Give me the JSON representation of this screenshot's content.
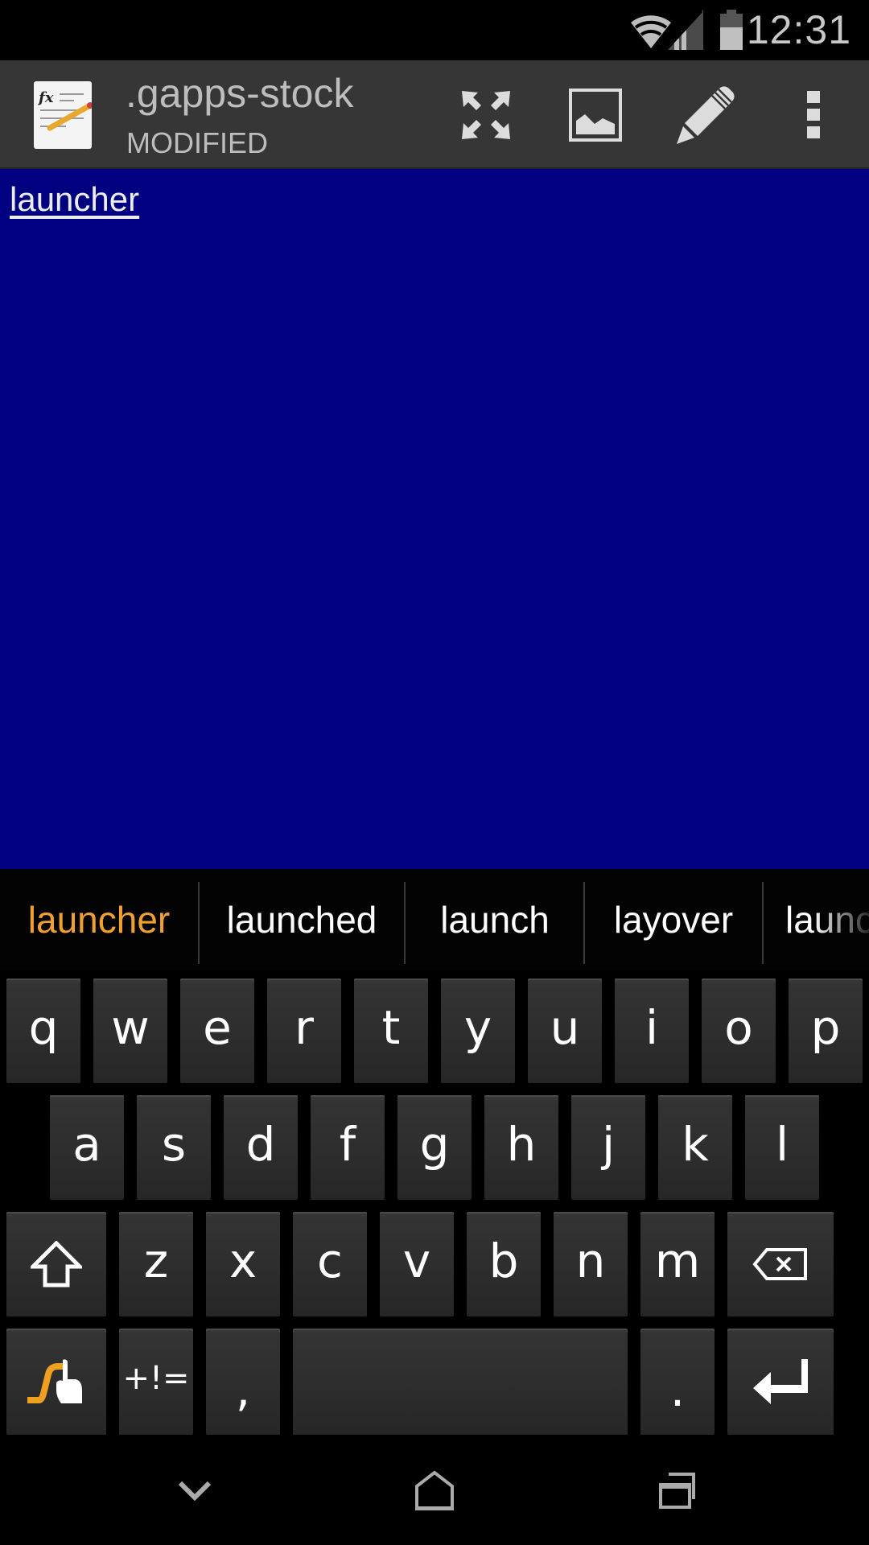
{
  "status_bar": {
    "time": "12:31",
    "icons": [
      "wifi-icon",
      "cell-signal-icon",
      "battery-icon"
    ]
  },
  "action_bar": {
    "app_icon": "text-editor-app-icon",
    "title": ".gapps-stock",
    "subtitle": "MODIFIED",
    "actions": [
      {
        "name": "fullscreen",
        "icon": "expand-arrows-icon"
      },
      {
        "name": "insert-image",
        "icon": "image-icon"
      },
      {
        "name": "edit",
        "icon": "pencil-icon"
      },
      {
        "name": "overflow-menu",
        "icon": "more-vertical-icon"
      }
    ]
  },
  "editor": {
    "content": "launcher",
    "background_color": "#000080"
  },
  "suggestions": {
    "items": [
      {
        "label": "launcher",
        "active": true
      },
      {
        "label": "launched",
        "active": false
      },
      {
        "label": "launch",
        "active": false
      },
      {
        "label": "layover",
        "active": false
      },
      {
        "label": "launches",
        "active": false
      }
    ],
    "accent_color": "#f0a030"
  },
  "keyboard": {
    "row1": [
      "q",
      "w",
      "e",
      "r",
      "t",
      "y",
      "u",
      "i",
      "o",
      "p"
    ],
    "row2": [
      "a",
      "s",
      "d",
      "f",
      "g",
      "h",
      "j",
      "k",
      "l"
    ],
    "row3": [
      "z",
      "x",
      "c",
      "v",
      "b",
      "n",
      "m"
    ],
    "shift_icon": "shift-arrow-icon",
    "backspace_icon": "backspace-icon",
    "swype_icon": "swype-icon",
    "symbols_label": "+!=",
    "comma_label": ",",
    "space_label": "",
    "period_label": ".",
    "enter_icon": "enter-icon"
  },
  "nav_bar": {
    "buttons": [
      {
        "name": "hide-keyboard",
        "icon": "chevron-down-icon"
      },
      {
        "name": "home",
        "icon": "home-icon"
      },
      {
        "name": "recents",
        "icon": "recent-apps-icon"
      }
    ]
  }
}
